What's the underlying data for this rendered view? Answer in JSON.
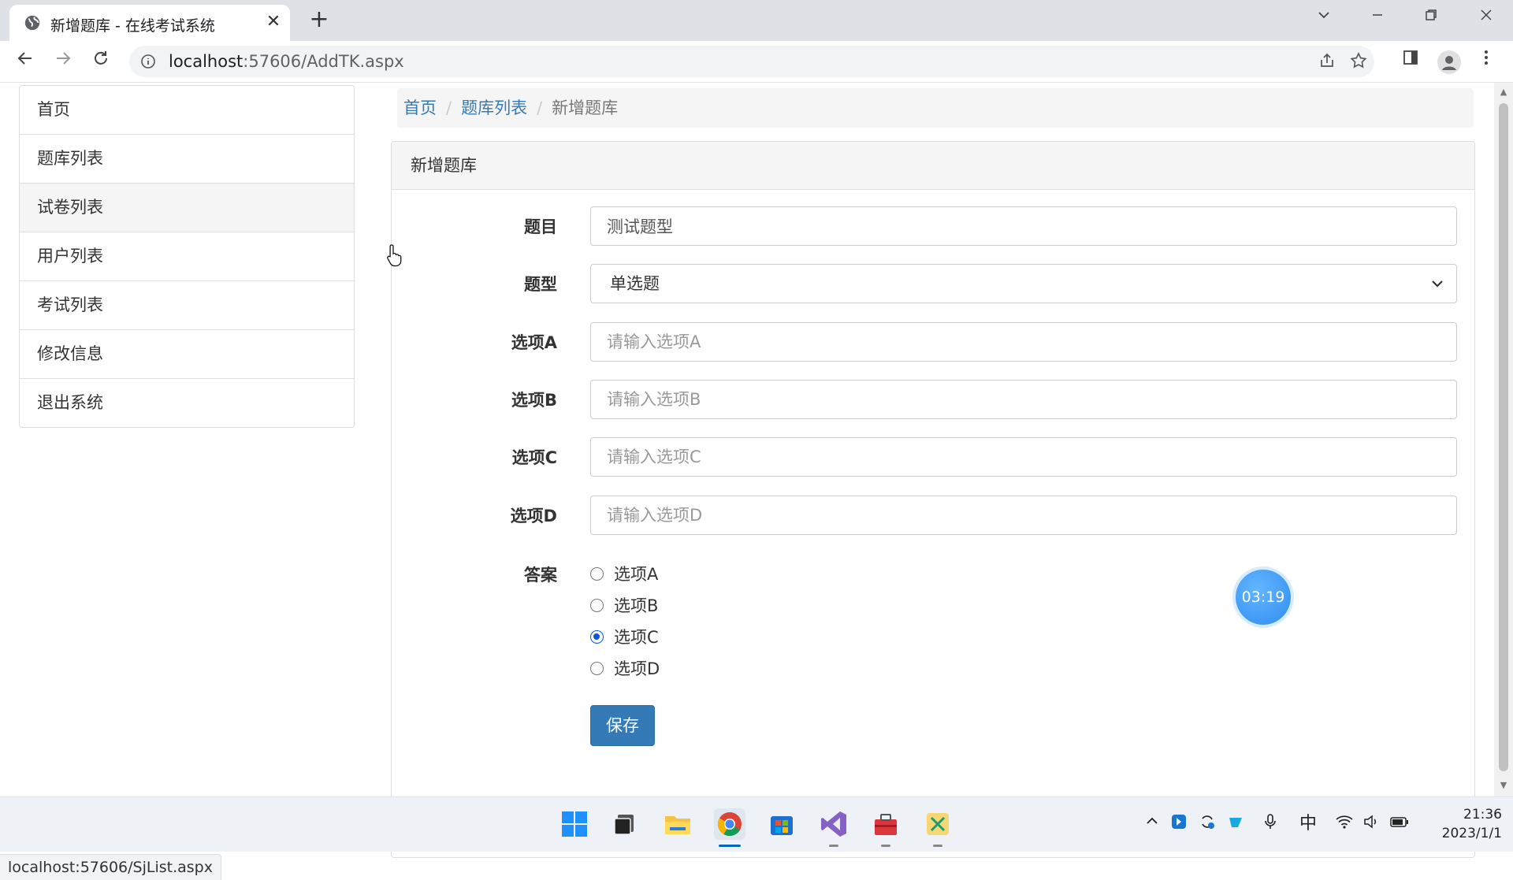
{
  "browser": {
    "tab_title": "新增题库 - 在线考试系统",
    "tab_close": "✕",
    "new_tab": "+",
    "url_host": "localhost",
    "url_rest": ":57606/AddTK.aspx",
    "status_url": "localhost:57606/SjList.aspx"
  },
  "sidebar": {
    "items": [
      {
        "label": "首页"
      },
      {
        "label": "题库列表"
      },
      {
        "label": "试卷列表"
      },
      {
        "label": "用户列表"
      },
      {
        "label": "考试列表"
      },
      {
        "label": "修改信息"
      },
      {
        "label": "退出系统"
      }
    ],
    "hovered_index": 2
  },
  "breadcrumb": {
    "items": [
      "首页",
      "题库列表"
    ],
    "separator": "/",
    "current": "新增题库"
  },
  "panel": {
    "heading": "新增题库"
  },
  "form": {
    "title_label": "题目",
    "title_value": "测试题型",
    "type_label": "题型",
    "type_value": "单选题",
    "option_a_label": "选项A",
    "option_a_placeholder": "请输入选项A",
    "option_b_label": "选项B",
    "option_b_placeholder": "请输入选项B",
    "option_c_label": "选项C",
    "option_c_placeholder": "请输入选项C",
    "option_d_label": "选项D",
    "option_d_placeholder": "请输入选项D",
    "answer_label": "答案",
    "answers": [
      {
        "label": "选项A",
        "checked": false
      },
      {
        "label": "选项B",
        "checked": false
      },
      {
        "label": "选项C",
        "checked": true
      },
      {
        "label": "选项D",
        "checked": false
      }
    ],
    "save_label": "保存"
  },
  "timer": "03:19",
  "taskbar": {
    "time": "21:36",
    "date": "2023/1/1",
    "ime": "中"
  },
  "colors": {
    "primary": "#337ab7",
    "link": "#337ab7",
    "radio_checked": "#0b57d0",
    "timer": "#2f8cf0"
  }
}
